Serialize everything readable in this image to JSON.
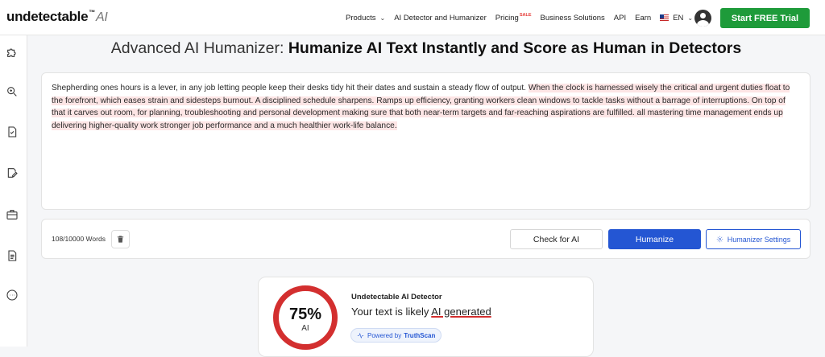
{
  "logo": {
    "main": "undetectable",
    "mark": "™",
    "suffix": "AI"
  },
  "nav": {
    "items": [
      {
        "label": "Products",
        "dropdown": true
      },
      {
        "label": "AI Detector and Humanizer"
      },
      {
        "label": "Pricing",
        "badge": "SALE"
      },
      {
        "label": "Business Solutions"
      },
      {
        "label": "API"
      },
      {
        "label": "Earn"
      }
    ],
    "language": "EN",
    "cta_label": "Start FREE Trial"
  },
  "sidebar": {
    "icons": [
      "puzzle-icon",
      "search-zoom-icon",
      "document-check-icon",
      "edit-document-icon",
      "briefcase-icon",
      "document-text-icon",
      "more-circle-icon"
    ]
  },
  "title": {
    "prefix": "Advanced AI Humanizer:",
    "bold": "Humanize AI Text Instantly and Score as Human in Detectors"
  },
  "editor": {
    "plain_text": "Shepherding ones hours is a lever, in any job letting people keep their desks tidy hit their dates and sustain a steady flow of output.",
    "highlighted_text": "When the clock is harnessed wisely the critical and urgent duties float to the forefront, which eases strain and sidesteps burnout. A disciplined schedule sharpens. Ramps up efficiency, granting workers clean windows to tackle tasks without a barrage of interruptions. On top of that it carves out room, for planning, troubleshooting and personal development making sure that both near-term targets and far-reaching aspirations are fulfilled. all mastering time management ends up delivering higher-quality work stronger job performance and a much healthier work-life balance."
  },
  "actions": {
    "word_count": "108/10000 Words",
    "check_label": "Check for AI",
    "humanize_label": "Humanize",
    "settings_label": "Humanizer Settings"
  },
  "detector": {
    "score": "75%",
    "score_label": "AI",
    "title": "Undetectable AI Detector",
    "result_prefix": "Your text is likely ",
    "result_verdict": "AI generated",
    "powered_prefix": "Powered by",
    "powered_brand": "TruthScan"
  },
  "colors": {
    "cta_green": "#1e9b3a",
    "primary_blue": "#2456d3",
    "ai_red": "#d32f2f",
    "highlight_pink": "#fde5e5"
  }
}
